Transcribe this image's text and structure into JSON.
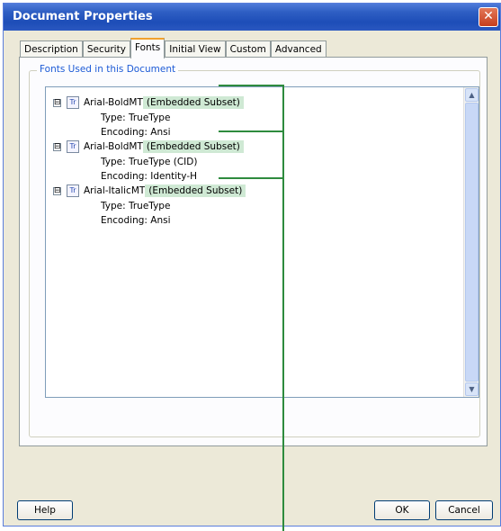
{
  "window": {
    "title": "Document Properties",
    "close_glyph": "✕"
  },
  "tabs": [
    {
      "label": "Description",
      "active": false
    },
    {
      "label": "Security",
      "active": false
    },
    {
      "label": "Fonts",
      "active": true
    },
    {
      "label": "Initial View",
      "active": false
    },
    {
      "label": "Custom",
      "active": false
    },
    {
      "label": "Advanced",
      "active": false
    }
  ],
  "fonts_group": {
    "legend": "Fonts Used in this Document"
  },
  "fonts": [
    {
      "name": "Arial-BoldMT",
      "embedded": "(Embedded Subset)",
      "type": "Type: TrueType",
      "encoding": "Encoding: Ansi"
    },
    {
      "name": "Arial-BoldMT",
      "embedded": "(Embedded Subset)",
      "type": "Type: TrueType (CID)",
      "encoding": "Encoding: Identity-H"
    },
    {
      "name": "Arial-ItalicMT",
      "embedded": "(Embedded Subset)",
      "type": "Type: TrueType",
      "encoding": "Encoding: Ansi"
    }
  ],
  "icons": {
    "expander": "⊟",
    "font": "Tr",
    "scroll_up": "▲",
    "scroll_down": "▼"
  },
  "buttons": {
    "help": "Help",
    "ok": "OK",
    "cancel": "Cancel"
  },
  "colors": {
    "callout": "#2e8b3e",
    "embedded_highlight": "#cfe9d4",
    "title_bar": "#1d4db8"
  }
}
